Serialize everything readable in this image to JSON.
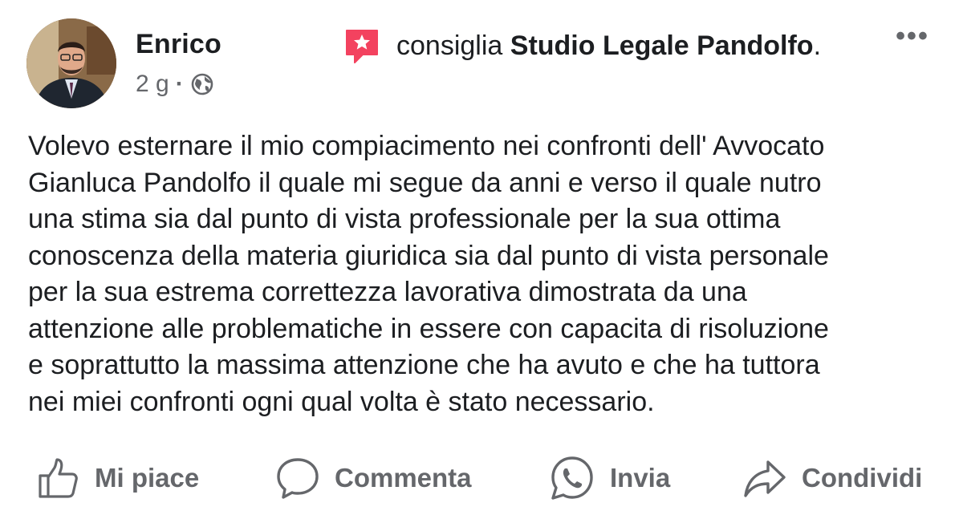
{
  "post": {
    "author": "Enrico",
    "time": "2 g",
    "separator": "·",
    "recommend_verb": "consiglia",
    "recommend_target": "Studio Legale Pandolfo",
    "recommend_end": ".",
    "more_label": "•••",
    "body_lines": [
      "Volevo esternare il mio compiacimento nei confronti dell' Avvocato",
      "Gianluca Pandolfo il quale mi segue da anni e verso il quale nutro",
      "una stima sia dal punto di vista professionale per la sua ottima",
      "conoscenza della materia giuridica sia dal punto di vista personale",
      "per la sua estrema correttezza lavorativa dimostrata da una",
      "attenzione alle problematiche in essere con capacita di risoluzione",
      "e soprattutto la massima attenzione che ha avuto e che ha tuttora",
      "nei miei confronti ogni qual volta è stato necessario."
    ]
  },
  "actions": {
    "like": "Mi piace",
    "comment": "Commenta",
    "send": "Invia",
    "share": "Condividi"
  },
  "icons": {
    "recommend": "recommend-star-icon",
    "privacy": "globe-icon",
    "like": "thumbs-up-icon",
    "comment": "comment-bubble-icon",
    "send": "whatsapp-icon",
    "share": "share-arrow-icon"
  },
  "colors": {
    "text": "#1c1e21",
    "secondary": "#65676b",
    "recommend_accent": "#f3425f"
  }
}
